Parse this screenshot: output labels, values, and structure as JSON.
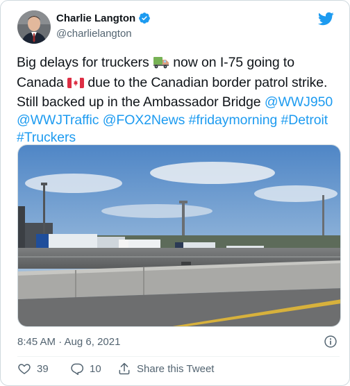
{
  "author": {
    "display_name": "Charlie Langton",
    "handle": "@charlielangton",
    "verified": true
  },
  "tweet": {
    "text_1": "Big delays for truckers ",
    "emoji_truck": "truck-emoji",
    "text_2": " now on I-75 going to Canada ",
    "emoji_flag": "canada-flag-emoji",
    "text_3": " due to the Canadian border patrol strike. Still backed up in the Ambassador Bridge ",
    "links": [
      "@WWJ950",
      "@WWJTraffic",
      "@FOX2News",
      "#fridaymorning",
      "#Detroit",
      "#Truckers"
    ]
  },
  "timestamp": "8:45 AM · Aug 6, 2021",
  "actions": {
    "like_count": "39",
    "reply_count": "10",
    "share_label": "Share this Tweet"
  },
  "colors": {
    "brand": "#1d9bf0",
    "text_primary": "#0f1419",
    "text_secondary": "#536471",
    "like_red": "#f91880"
  },
  "icons": [
    "verified-badge-icon",
    "twitter-bird-icon",
    "info-icon",
    "heart-icon",
    "reply-icon",
    "share-icon"
  ]
}
